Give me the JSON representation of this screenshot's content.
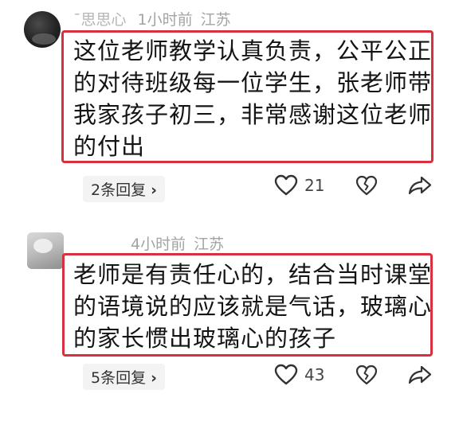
{
  "comments": [
    {
      "username": "¯思思心",
      "time": "1小时前",
      "location": "江苏",
      "text": "这位老师教学认真负责，公平公正\n的对待班级每一位学生，张老师带\n我家孩子初三，非常感谢这位老师\n的付出",
      "replies_label": "2条回复",
      "likes": "21"
    },
    {
      "username": "",
      "time": "4小时前",
      "location": "江苏",
      "text": "老师是有责任心的，结合当时课堂\n的语境说的应该就是气话，玻璃心\n的家长惯出玻璃心的孩子",
      "replies_label": "5条回复",
      "likes": "43"
    }
  ],
  "icons": {
    "reply_chevron": "chevron-right-icon",
    "like": "heart-outline-icon",
    "dislike": "broken-heart-icon",
    "share": "share-arrow-icon"
  },
  "colors": {
    "highlight_border": "#d8303e",
    "meta_text": "#a3a3a3",
    "body_text": "#141414"
  }
}
